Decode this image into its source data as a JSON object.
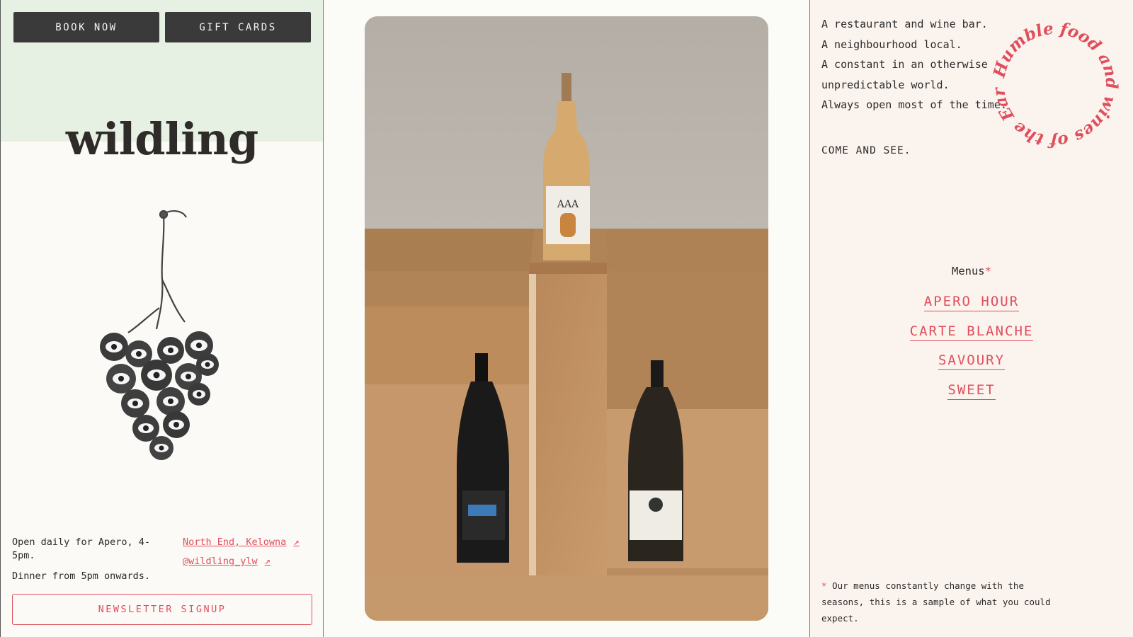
{
  "left": {
    "book_label": "BOOK NOW",
    "gift_label": "GIFT CARDS",
    "logo": "wildling",
    "hours_line1": "Open daily for Apero, 4-5pm.",
    "hours_line2": "Dinner from 5pm onwards.",
    "location_link": "North End, Kelowna",
    "instagram_link": "@wildling_ylw",
    "newsletter_label": "NEWSLETTER SIGNUP"
  },
  "right": {
    "about": [
      "A restaurant and wine bar.",
      "A neighbourhood local.",
      "A constant in an otherwise",
      "unpredictable world.",
      "Always open most of the time."
    ],
    "come_and_see": "COME AND SEE.",
    "badge_text": "Humble food and wines of the Earth.",
    "menus_title": "Menus",
    "menus_asterisk": "*",
    "menu_items": [
      "APERO HOUR",
      "CARTE BLANCHE",
      "SAVOURY",
      "SWEET"
    ],
    "note_asterisk": "*",
    "note": "Our menus constantly change with the seasons, this is a sample of what you could expect."
  },
  "colors": {
    "accent": "#e04e5c",
    "dark_button": "#3a3a3a",
    "green_band": "#e6f1e3",
    "right_bg": "#fbf3ee"
  }
}
